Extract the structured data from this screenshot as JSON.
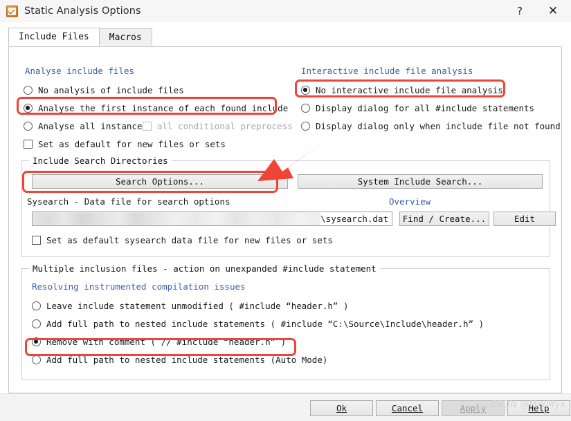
{
  "window": {
    "title": "Static Analysis Options",
    "icon": "checkbox-app-icon",
    "help_glyph": "?",
    "close_glyph": "✕"
  },
  "tabs": [
    {
      "label": "Include Files",
      "active": true
    },
    {
      "label": "Macros",
      "active": false
    }
  ],
  "analyse_include_files": {
    "legend": "Analyse include files",
    "options": [
      {
        "label": "No analysis of include files",
        "selected": false
      },
      {
        "label": "Analyse the first instance of each found include",
        "selected": true,
        "highlighted": true
      },
      {
        "label": "Analyse all instances",
        "selected": false
      }
    ],
    "conditional_checkbox": {
      "label": "all conditional preprocess",
      "checked": false,
      "disabled": true
    },
    "default_checkbox": {
      "label": "Set as default for new files or sets",
      "checked": false
    }
  },
  "interactive_include": {
    "legend": "Interactive include file analysis",
    "options": [
      {
        "label": "No interactive include file analysis",
        "selected": true,
        "highlighted": true
      },
      {
        "label": "Display dialog for all #include statements",
        "selected": false
      },
      {
        "label": "Display dialog only when include file not found",
        "selected": false
      }
    ]
  },
  "include_search_directories": {
    "legend": "Include Search Directories",
    "search_options_button": "Search Options...",
    "system_include_button": "System Include Search...",
    "sysearch_label": "Sysearch - Data file for search options",
    "overview_link": "Overview",
    "path_field": {
      "value_tail": "\\sysearch.dat",
      "redacted": true
    },
    "find_create_button": "Find / Create...",
    "edit_button": "Edit",
    "default_checkbox": {
      "label": "Set as default sysearch data file for new files or sets",
      "checked": false
    }
  },
  "multiple_inclusion": {
    "legend": "Multiple inclusion files - action on unexpanded #include statement",
    "sublegend": "Resolving instrumented compilation issues",
    "options": [
      {
        "label": "Leave include statement unmodified ( #include “header.h” )",
        "selected": false
      },
      {
        "label": "Add full path to nested include statements ( #include “C:\\Source\\Include\\header.h” )",
        "selected": false
      },
      {
        "label": "Remove with comment ( // #include “header.h” )",
        "selected": true,
        "highlighted": true
      },
      {
        "label": "Add full path to nested include statements (Auto Mode)",
        "selected": false
      }
    ]
  },
  "footer": {
    "ok": "Ok",
    "cancel": "Cancel",
    "apply": "Apply",
    "help": "Help",
    "apply_disabled": true,
    "watermark": "CSDN @MrxMyx"
  },
  "colors": {
    "highlight": "#f04438",
    "legend_blue": "#3b5fa4",
    "link_blue": "#3b5fa4"
  }
}
